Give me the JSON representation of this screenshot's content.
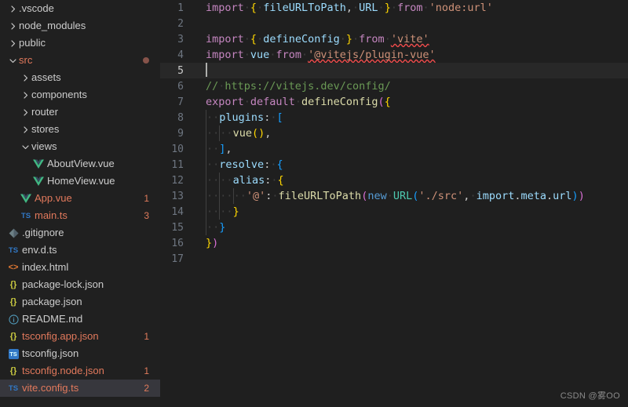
{
  "window": {
    "title": "vite.config.ts"
  },
  "explorer": {
    "items": [
      {
        "name": "folder-vscode",
        "label": ".vscode",
        "kind": "folder",
        "depth": 0,
        "state": "collapsed",
        "icon": "chevron-right-icon",
        "badge": "",
        "error": false,
        "selected": false
      },
      {
        "name": "folder-node-modules",
        "label": "node_modules",
        "kind": "folder",
        "depth": 0,
        "state": "collapsed",
        "icon": "chevron-right-icon",
        "badge": "",
        "error": false,
        "selected": false
      },
      {
        "name": "folder-public",
        "label": "public",
        "kind": "folder",
        "depth": 0,
        "state": "collapsed",
        "icon": "chevron-right-icon",
        "badge": "",
        "error": false,
        "selected": false
      },
      {
        "name": "folder-src",
        "label": "src",
        "kind": "folder",
        "depth": 0,
        "state": "expanded",
        "icon": "chevron-down-icon",
        "badge": "dot",
        "error": true,
        "selected": false
      },
      {
        "name": "folder-assets",
        "label": "assets",
        "kind": "folder",
        "depth": 1,
        "state": "collapsed",
        "icon": "chevron-right-icon",
        "badge": "",
        "error": false,
        "selected": false
      },
      {
        "name": "folder-components",
        "label": "components",
        "kind": "folder",
        "depth": 1,
        "state": "collapsed",
        "icon": "chevron-right-icon",
        "badge": "",
        "error": false,
        "selected": false
      },
      {
        "name": "folder-router",
        "label": "router",
        "kind": "folder",
        "depth": 1,
        "state": "collapsed",
        "icon": "chevron-right-icon",
        "badge": "",
        "error": false,
        "selected": false
      },
      {
        "name": "folder-stores",
        "label": "stores",
        "kind": "folder",
        "depth": 1,
        "state": "collapsed",
        "icon": "chevron-right-icon",
        "badge": "",
        "error": false,
        "selected": false
      },
      {
        "name": "folder-views",
        "label": "views",
        "kind": "folder",
        "depth": 1,
        "state": "expanded",
        "icon": "chevron-down-icon",
        "badge": "",
        "error": false,
        "selected": false
      },
      {
        "name": "file-about-view",
        "label": "AboutView.vue",
        "kind": "vue",
        "depth": 2,
        "state": "",
        "icon": "vue-file-icon",
        "badge": "",
        "error": false,
        "selected": false
      },
      {
        "name": "file-home-view",
        "label": "HomeView.vue",
        "kind": "vue",
        "depth": 2,
        "state": "",
        "icon": "vue-file-icon",
        "badge": "",
        "error": false,
        "selected": false
      },
      {
        "name": "file-app-vue",
        "label": "App.vue",
        "kind": "vue",
        "depth": 1,
        "state": "",
        "icon": "vue-file-icon",
        "badge": "1",
        "error": true,
        "selected": false
      },
      {
        "name": "file-main-ts",
        "label": "main.ts",
        "kind": "ts",
        "depth": 1,
        "state": "",
        "icon": "ts-file-icon",
        "badge": "3",
        "error": true,
        "selected": false
      },
      {
        "name": "file-gitignore",
        "label": ".gitignore",
        "kind": "git",
        "depth": 0,
        "state": "",
        "icon": "git-file-icon",
        "badge": "",
        "error": false,
        "selected": false
      },
      {
        "name": "file-env-d-ts",
        "label": "env.d.ts",
        "kind": "ts",
        "depth": 0,
        "state": "",
        "icon": "ts-file-icon",
        "badge": "",
        "error": false,
        "selected": false
      },
      {
        "name": "file-index-html",
        "label": "index.html",
        "kind": "html",
        "depth": 0,
        "state": "",
        "icon": "html-file-icon",
        "badge": "",
        "error": false,
        "selected": false
      },
      {
        "name": "file-package-lock",
        "label": "package-lock.json",
        "kind": "json",
        "depth": 0,
        "state": "",
        "icon": "json-file-icon",
        "badge": "",
        "error": false,
        "selected": false
      },
      {
        "name": "file-package-json",
        "label": "package.json",
        "kind": "json",
        "depth": 0,
        "state": "",
        "icon": "json-file-icon",
        "badge": "",
        "error": false,
        "selected": false
      },
      {
        "name": "file-readme",
        "label": "README.md",
        "kind": "md",
        "depth": 0,
        "state": "",
        "icon": "markdown-file-icon",
        "badge": "",
        "error": false,
        "selected": false
      },
      {
        "name": "file-tsconfig-app",
        "label": "tsconfig.app.json",
        "kind": "json",
        "depth": 0,
        "state": "",
        "icon": "json-file-icon",
        "badge": "1",
        "error": true,
        "selected": false
      },
      {
        "name": "file-tsconfig-json",
        "label": "tsconfig.json",
        "kind": "tsconf",
        "depth": 0,
        "state": "",
        "icon": "tsconfig-file-icon",
        "badge": "",
        "error": false,
        "selected": false
      },
      {
        "name": "file-tsconfig-node",
        "label": "tsconfig.node.json",
        "kind": "json",
        "depth": 0,
        "state": "",
        "icon": "json-file-icon",
        "badge": "1",
        "error": true,
        "selected": false
      },
      {
        "name": "file-vite-config",
        "label": "vite.config.ts",
        "kind": "ts",
        "depth": 0,
        "state": "",
        "icon": "ts-file-icon",
        "badge": "2",
        "error": true,
        "selected": true
      }
    ]
  },
  "editor": {
    "active_line": 5,
    "cursor_line": 5,
    "cursor_column": 1,
    "line_numbers": [
      "1",
      "2",
      "3",
      "4",
      "5",
      "6",
      "7",
      "8",
      "9",
      "10",
      "11",
      "12",
      "13",
      "14",
      "15",
      "16",
      "17"
    ],
    "lines": [
      "import { fileURLToPath, URL } from 'node:url'",
      "",
      "import { defineConfig } from 'vite'",
      "import vue from '@vitejs/plugin-vue'",
      "",
      "// https://vitejs.dev/config/",
      "export default defineConfig({",
      "  plugins: [",
      "    vue(),",
      "  ],",
      "  resolve: {",
      "    alias: {",
      "      '@': fileURLToPath(new URL('./src', import.meta.url))",
      "    }",
      "  }",
      "})",
      ""
    ],
    "diagnostics": [
      {
        "line": 3,
        "token": "'vite'",
        "severity": "error"
      },
      {
        "line": 4,
        "token": "'@vitejs/plugin-vue'",
        "severity": "error"
      }
    ]
  },
  "watermark": {
    "text": "CSDN @雾OO"
  },
  "colors": {
    "sidebar_bg": "#202020",
    "editor_bg": "#1f1f1f",
    "selected_row_bg": "#37373d",
    "active_line_bg": "#282828",
    "error_fg": "#e2795c",
    "badge_fg": "#e07b5c",
    "linenum_fg": "#6e7681",
    "linenum_active_fg": "#cccccc",
    "text_fg": "#cccccc",
    "keyword": "#c586c0",
    "string": "#ce9178",
    "comment": "#6a9955",
    "function": "#dcdcaa",
    "identifier": "#9cdcfe",
    "class": "#4ec9b0",
    "bracket1": "#ffd700",
    "bracket2": "#da70d6",
    "bracket3": "#179fff",
    "squiggle": "#f14c4c",
    "vue_green": "#41b883",
    "ts_blue": "#3178c6",
    "html_orange": "#e37933",
    "json_yellow": "#cbcb41",
    "md_blue": "#519aba"
  }
}
